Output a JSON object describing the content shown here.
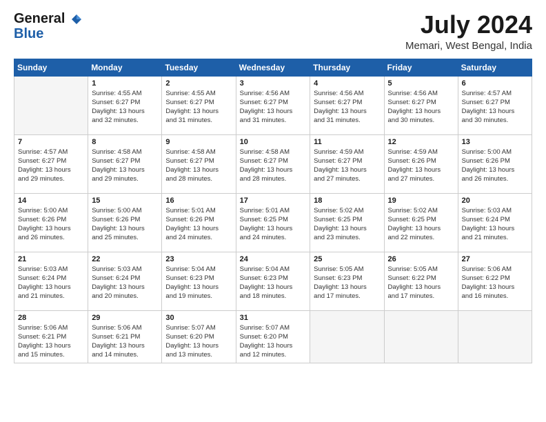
{
  "logo": {
    "line1": "General",
    "line2": "Blue"
  },
  "title": {
    "month_year": "July 2024",
    "location": "Memari, West Bengal, India"
  },
  "days_of_week": [
    "Sunday",
    "Monday",
    "Tuesday",
    "Wednesday",
    "Thursday",
    "Friday",
    "Saturday"
  ],
  "weeks": [
    [
      {
        "day": "",
        "info": ""
      },
      {
        "day": "1",
        "info": "Sunrise: 4:55 AM\nSunset: 6:27 PM\nDaylight: 13 hours\nand 32 minutes."
      },
      {
        "day": "2",
        "info": "Sunrise: 4:55 AM\nSunset: 6:27 PM\nDaylight: 13 hours\nand 31 minutes."
      },
      {
        "day": "3",
        "info": "Sunrise: 4:56 AM\nSunset: 6:27 PM\nDaylight: 13 hours\nand 31 minutes."
      },
      {
        "day": "4",
        "info": "Sunrise: 4:56 AM\nSunset: 6:27 PM\nDaylight: 13 hours\nand 31 minutes."
      },
      {
        "day": "5",
        "info": "Sunrise: 4:56 AM\nSunset: 6:27 PM\nDaylight: 13 hours\nand 30 minutes."
      },
      {
        "day": "6",
        "info": "Sunrise: 4:57 AM\nSunset: 6:27 PM\nDaylight: 13 hours\nand 30 minutes."
      }
    ],
    [
      {
        "day": "7",
        "info": "Sunrise: 4:57 AM\nSunset: 6:27 PM\nDaylight: 13 hours\nand 29 minutes."
      },
      {
        "day": "8",
        "info": "Sunrise: 4:58 AM\nSunset: 6:27 PM\nDaylight: 13 hours\nand 29 minutes."
      },
      {
        "day": "9",
        "info": "Sunrise: 4:58 AM\nSunset: 6:27 PM\nDaylight: 13 hours\nand 28 minutes."
      },
      {
        "day": "10",
        "info": "Sunrise: 4:58 AM\nSunset: 6:27 PM\nDaylight: 13 hours\nand 28 minutes."
      },
      {
        "day": "11",
        "info": "Sunrise: 4:59 AM\nSunset: 6:27 PM\nDaylight: 13 hours\nand 27 minutes."
      },
      {
        "day": "12",
        "info": "Sunrise: 4:59 AM\nSunset: 6:26 PM\nDaylight: 13 hours\nand 27 minutes."
      },
      {
        "day": "13",
        "info": "Sunrise: 5:00 AM\nSunset: 6:26 PM\nDaylight: 13 hours\nand 26 minutes."
      }
    ],
    [
      {
        "day": "14",
        "info": "Sunrise: 5:00 AM\nSunset: 6:26 PM\nDaylight: 13 hours\nand 26 minutes."
      },
      {
        "day": "15",
        "info": "Sunrise: 5:00 AM\nSunset: 6:26 PM\nDaylight: 13 hours\nand 25 minutes."
      },
      {
        "day": "16",
        "info": "Sunrise: 5:01 AM\nSunset: 6:26 PM\nDaylight: 13 hours\nand 24 minutes."
      },
      {
        "day": "17",
        "info": "Sunrise: 5:01 AM\nSunset: 6:25 PM\nDaylight: 13 hours\nand 24 minutes."
      },
      {
        "day": "18",
        "info": "Sunrise: 5:02 AM\nSunset: 6:25 PM\nDaylight: 13 hours\nand 23 minutes."
      },
      {
        "day": "19",
        "info": "Sunrise: 5:02 AM\nSunset: 6:25 PM\nDaylight: 13 hours\nand 22 minutes."
      },
      {
        "day": "20",
        "info": "Sunrise: 5:03 AM\nSunset: 6:24 PM\nDaylight: 13 hours\nand 21 minutes."
      }
    ],
    [
      {
        "day": "21",
        "info": "Sunrise: 5:03 AM\nSunset: 6:24 PM\nDaylight: 13 hours\nand 21 minutes."
      },
      {
        "day": "22",
        "info": "Sunrise: 5:03 AM\nSunset: 6:24 PM\nDaylight: 13 hours\nand 20 minutes."
      },
      {
        "day": "23",
        "info": "Sunrise: 5:04 AM\nSunset: 6:23 PM\nDaylight: 13 hours\nand 19 minutes."
      },
      {
        "day": "24",
        "info": "Sunrise: 5:04 AM\nSunset: 6:23 PM\nDaylight: 13 hours\nand 18 minutes."
      },
      {
        "day": "25",
        "info": "Sunrise: 5:05 AM\nSunset: 6:23 PM\nDaylight: 13 hours\nand 17 minutes."
      },
      {
        "day": "26",
        "info": "Sunrise: 5:05 AM\nSunset: 6:22 PM\nDaylight: 13 hours\nand 17 minutes."
      },
      {
        "day": "27",
        "info": "Sunrise: 5:06 AM\nSunset: 6:22 PM\nDaylight: 13 hours\nand 16 minutes."
      }
    ],
    [
      {
        "day": "28",
        "info": "Sunrise: 5:06 AM\nSunset: 6:21 PM\nDaylight: 13 hours\nand 15 minutes."
      },
      {
        "day": "29",
        "info": "Sunrise: 5:06 AM\nSunset: 6:21 PM\nDaylight: 13 hours\nand 14 minutes."
      },
      {
        "day": "30",
        "info": "Sunrise: 5:07 AM\nSunset: 6:20 PM\nDaylight: 13 hours\nand 13 minutes."
      },
      {
        "day": "31",
        "info": "Sunrise: 5:07 AM\nSunset: 6:20 PM\nDaylight: 13 hours\nand 12 minutes."
      },
      {
        "day": "",
        "info": ""
      },
      {
        "day": "",
        "info": ""
      },
      {
        "day": "",
        "info": ""
      }
    ]
  ]
}
